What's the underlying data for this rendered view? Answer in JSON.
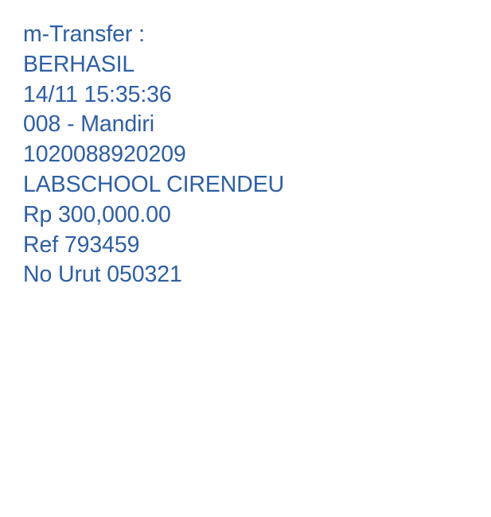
{
  "message": {
    "lines": [
      "m-Transfer :",
      "BERHASIL",
      "14/11 15:35:36",
      "008 - Mandiri",
      "1020088920209",
      "LABSCHOOL CIRENDEU",
      "Rp 300,000.00",
      "Ref 793459",
      "No Urut 050321"
    ]
  },
  "colors": {
    "text": "#2e5fa3",
    "background": "#ffffff"
  }
}
